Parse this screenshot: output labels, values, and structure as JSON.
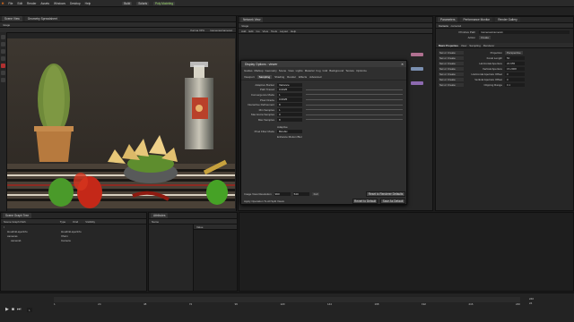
{
  "menubar": {
    "logo": "H",
    "items": [
      "File",
      "Edit",
      "Render",
      "Assets",
      "Windows",
      "Desktop",
      "Help"
    ],
    "extras": [
      "Build"
    ],
    "build_label": "Build",
    "desktop_label": "Solaris",
    "green_label": "Poly Modeling"
  },
  "left_pane": {
    "title": "Scene View",
    "tabs": [
      "Scene View",
      "Geometry Spreadsheet"
    ],
    "path": "/stage",
    "camera_label": "/cameras/camera1",
    "render_label": "Karma XPU"
  },
  "mid_pane": {
    "tabs": [
      "Network View",
      "/stage"
    ],
    "path": "/stage",
    "menu": [
      "Add",
      "Edit",
      "Go",
      "View",
      "Tools",
      "Layout",
      "Help"
    ]
  },
  "dialog": {
    "title": "Display Options : viewer",
    "tabs_top": [
      "Guides",
      "Markup",
      "Geometry",
      "Scene",
      "View",
      "Lights",
      "Material",
      "Fog",
      "Grid",
      "Background",
      "Texture",
      "Optimize"
    ],
    "tabs_sub": [
      "Viewport",
      "Sampling",
      "Shading",
      "Render",
      "Effects",
      "Advanced"
    ],
    "rows": [
      {
        "label": "Adaptive Bucket",
        "value": "Variance"
      },
      {
        "label": "Path Traced",
        "value": "0.0025"
      },
      {
        "label": "Convergence Mode",
        "value": "1"
      },
      {
        "label": "Pixel Oracle",
        "value": "0.0025"
      },
      {
        "label": "Interactive Refinement",
        "value": "8"
      },
      {
        "label": "Min Samples",
        "value": "1"
      },
      {
        "label": "Max Extra Samples",
        "value": "0"
      },
      {
        "label": "Max Samples",
        "value": "8"
      }
    ],
    "mode_label": "Pixel Filter Mode",
    "mode_value": "Bicubic",
    "checkbox1": "Adaptive",
    "checkbox2": "Enhance Motion Blur",
    "bottom_check": "Image View Resolution",
    "res_w": "960",
    "res_h": "540",
    "res_unit": "Full",
    "apply_check": "Apply Operation To All Split Views",
    "reset_btn": "Reset to Renderer Defaults",
    "revert_btn": "Revert to Default",
    "save_btn": "Save As Default"
  },
  "right_pane": {
    "tabs": [
      "Parameters",
      "Performance Monitor",
      "Render Gallery"
    ],
    "node_title": "Camera",
    "node_name": "camera1",
    "subtabs": [
      "Basic Properties",
      "View",
      "Sampling",
      "Renderer"
    ],
    "fields": [
      {
        "label": "Projection",
        "value": "Perspective"
      },
      {
        "label": "Focal Length",
        "value": "50"
      },
      {
        "label": "Horizontal Aperture",
        "value": "20.955"
      },
      {
        "label": "Vertical Aperture",
        "value": "15.2908"
      },
      {
        "label": "Horizontal Aperture Offset",
        "value": "0"
      },
      {
        "label": "Vertical Aperture Offset",
        "value": "0"
      },
      {
        "label": "Clipping Range",
        "value": "0.1"
      }
    ],
    "set_label": "Set or Create",
    "primitive_path": "/cameras/camera1",
    "action_label": "Create"
  },
  "scene_graph": {
    "title": "Scene Graph Tree",
    "columns": [
      "Scene Graph Path",
      "Type",
      "Kind",
      "Visibility"
    ],
    "rows": [
      {
        "name": "/",
        "type": "",
        "kind": "",
        "vis": ""
      },
      {
        "name": "HoudiniLayerInfo",
        "type": "HoudiniLayerInfo",
        "kind": "",
        "vis": ""
      },
      {
        "name": "cameras",
        "type": "Xform",
        "kind": "",
        "vis": ""
      },
      {
        "name": "camera1",
        "type": "Camera",
        "kind": "",
        "vis": ""
      }
    ]
  },
  "details": {
    "columns": [
      "Name",
      "Value"
    ],
    "label": "Value",
    "filter": "Attributes"
  },
  "timeline": {
    "frame": "1",
    "start": "1",
    "end": "240",
    "fps": "24",
    "labels": [
      "1",
      "24",
      "48",
      "72",
      "96",
      "120",
      "144",
      "168",
      "192",
      "216",
      "240"
    ]
  }
}
